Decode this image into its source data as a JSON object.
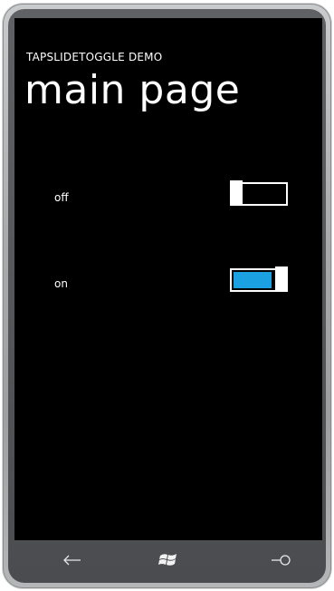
{
  "app": {
    "title": "TAPSLIDETOGGLE DEMO",
    "page_title": "main page"
  },
  "toggles": [
    {
      "label": "off",
      "is_on": false
    },
    {
      "label": "on",
      "is_on": true
    }
  ],
  "colors": {
    "accent": "#1ba1e2",
    "background": "#000000",
    "foreground": "#ffffff"
  },
  "hardware_buttons": [
    {
      "icon": "back-arrow-icon"
    },
    {
      "icon": "windows-start-icon"
    },
    {
      "icon": "search-icon"
    }
  ]
}
